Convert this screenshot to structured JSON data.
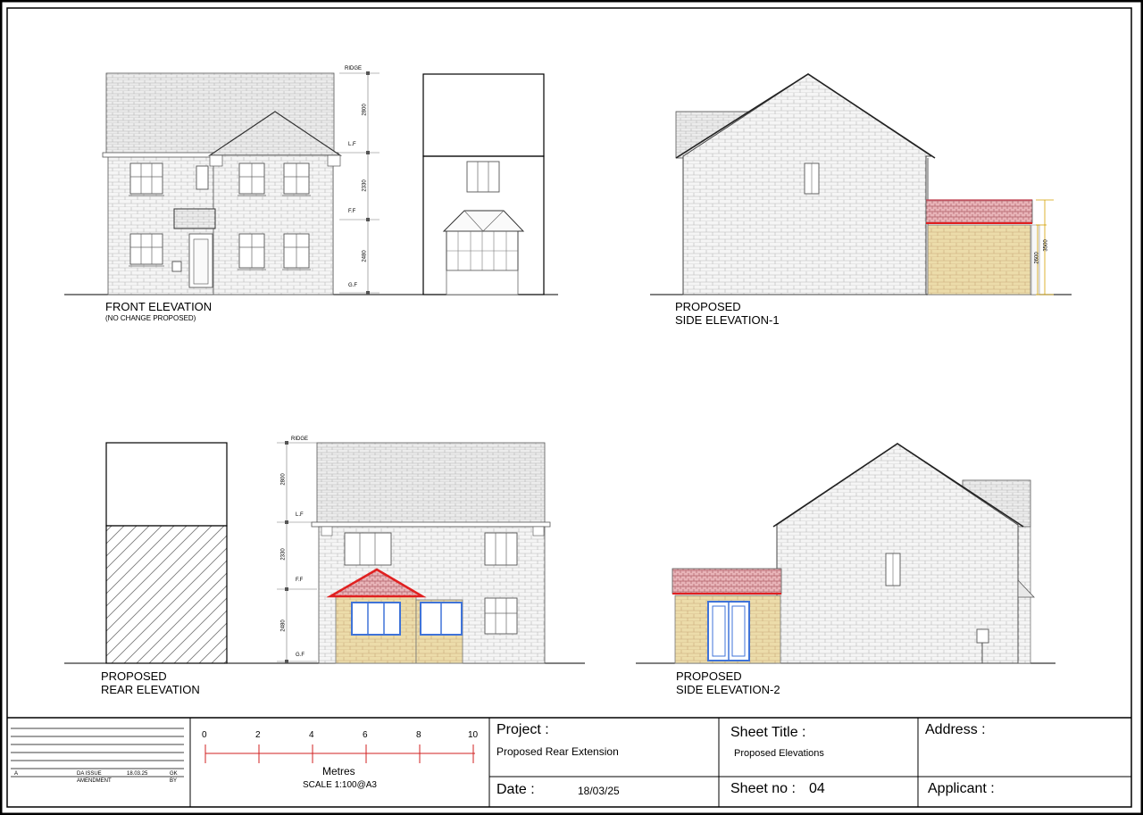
{
  "elevations": {
    "front": {
      "title": "FRONT ELEVATION",
      "note": "(NO CHANGE PROPOSED)"
    },
    "side1": {
      "title_line1": "PROPOSED",
      "title_line2": "SIDE ELEVATION-1"
    },
    "rear": {
      "title_line1": "PROPOSED",
      "title_line2": "REAR ELEVATION"
    },
    "side2": {
      "title_line1": "PROPOSED",
      "title_line2": "SIDE ELEVATION-2"
    }
  },
  "levels": {
    "ridge": "RIDGE",
    "lf": "L.F",
    "ff": "F.F",
    "gf": "G.F"
  },
  "dimensions": {
    "roof": "2800",
    "first": "2330",
    "ground": "2480",
    "ext_eaves": "2600",
    "ext_ridge": "3500"
  },
  "title_block": {
    "amendment": {
      "rev": "A",
      "desc": "DA ISSUE",
      "date": "18.03.25",
      "by": "GK",
      "header_amend": "AMENDMENT",
      "header_by": "BY"
    },
    "scale_ticks": [
      "0",
      "2",
      "4",
      "6",
      "8",
      "10"
    ],
    "scale_unit": "Metres",
    "scale_text": "SCALE 1:100@A3",
    "project_label": "Project :",
    "project_value": "Proposed Rear Extension",
    "sheet_title_label": "Sheet Title :",
    "sheet_title_value": "Proposed Elevations",
    "address_label": "Address :",
    "date_label": "Date :",
    "date_value": "18/03/25",
    "sheet_no_label": "Sheet no :",
    "sheet_no_value": "04",
    "applicant_label": "Applicant :"
  },
  "colors": {
    "brick": "#f4f4f4",
    "roof": "#ececec",
    "extension_brick": "#ecdcaa",
    "extension_roof": "#e8b2b6",
    "flashing": "#e02020",
    "window_new": "#3f73d8"
  }
}
